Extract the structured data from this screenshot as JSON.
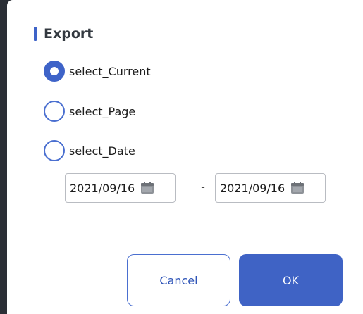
{
  "dialog": {
    "title": "Export",
    "accent_color": "#3e63c8"
  },
  "options": [
    {
      "label": "select_Current",
      "checked": true
    },
    {
      "label": "select_Page",
      "checked": false
    },
    {
      "label": "select_Date",
      "checked": false
    }
  ],
  "date_range": {
    "start": "2021/09/16",
    "separator": "-",
    "end": "2021/09/16",
    "icon": "calendar-icon"
  },
  "buttons": {
    "cancel_label": "Cancel",
    "ok_label": "OK"
  }
}
